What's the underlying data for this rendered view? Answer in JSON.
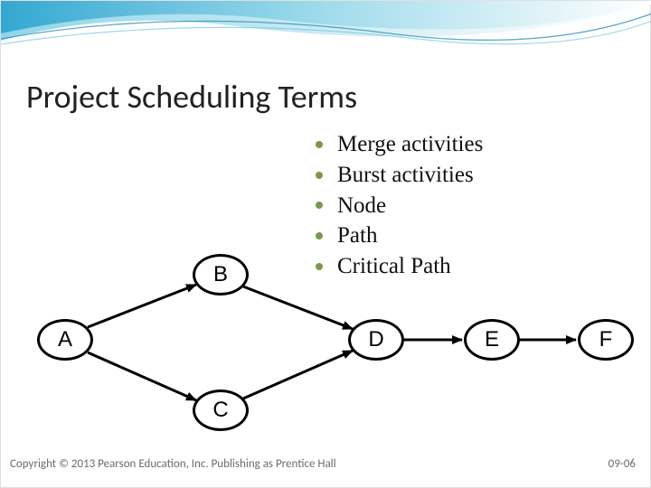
{
  "title": "Project Scheduling Terms",
  "bullets": [
    "Merge activities",
    "Burst activities",
    "Node",
    "Path",
    "Critical Path"
  ],
  "nodes": {
    "A": "A",
    "B": "B",
    "C": "C",
    "D": "D",
    "E": "E",
    "F": "F"
  },
  "footer": {
    "copyright": "Copyright © 2013 Pearson Education, Inc. Publishing as Prentice Hall",
    "page": "09-06"
  },
  "chart_data": {
    "type": "diagram",
    "description": "Activity-on-node network diagram",
    "nodes": [
      "A",
      "B",
      "C",
      "D",
      "E",
      "F"
    ],
    "edges": [
      [
        "A",
        "B"
      ],
      [
        "A",
        "C"
      ],
      [
        "B",
        "D"
      ],
      [
        "C",
        "D"
      ],
      [
        "D",
        "E"
      ],
      [
        "E",
        "F"
      ]
    ]
  }
}
